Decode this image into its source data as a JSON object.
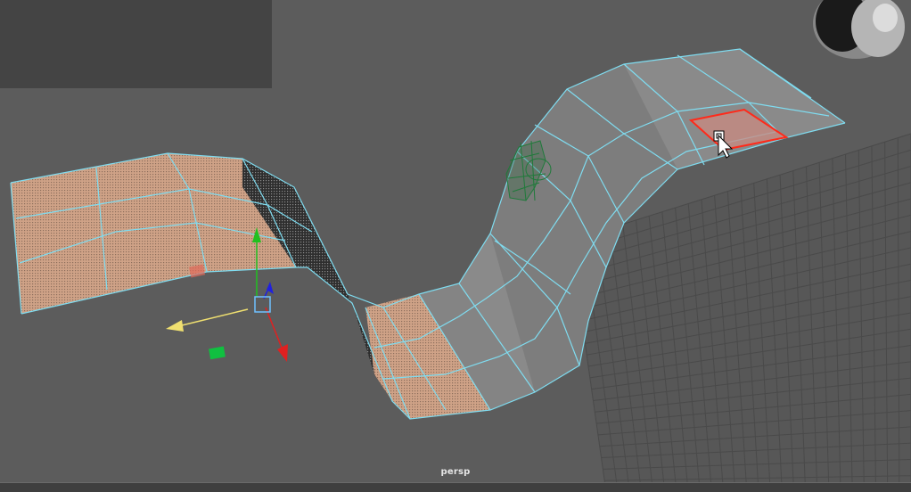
{
  "viewport": {
    "camera_label": "persp",
    "colors": {
      "background": "#5c5c5c",
      "grid": "#4a4a4a",
      "wireframe": "#7fdcf0",
      "face_selection": "#d9a98a",
      "selected_face_outline": "#ff2a1a",
      "manip_x_axis": "#e02020",
      "manip_y_axis": "#20c020",
      "manip_z_axis": "#2020e0",
      "manip_pivot": "#6ec0ff",
      "move_arrow": "#f0e070",
      "camera_object": "#1f7a3a"
    }
  },
  "scene": {
    "objects": [
      "curved-plane-mesh",
      "camera-object",
      "grid"
    ],
    "tool": "move-tool"
  }
}
